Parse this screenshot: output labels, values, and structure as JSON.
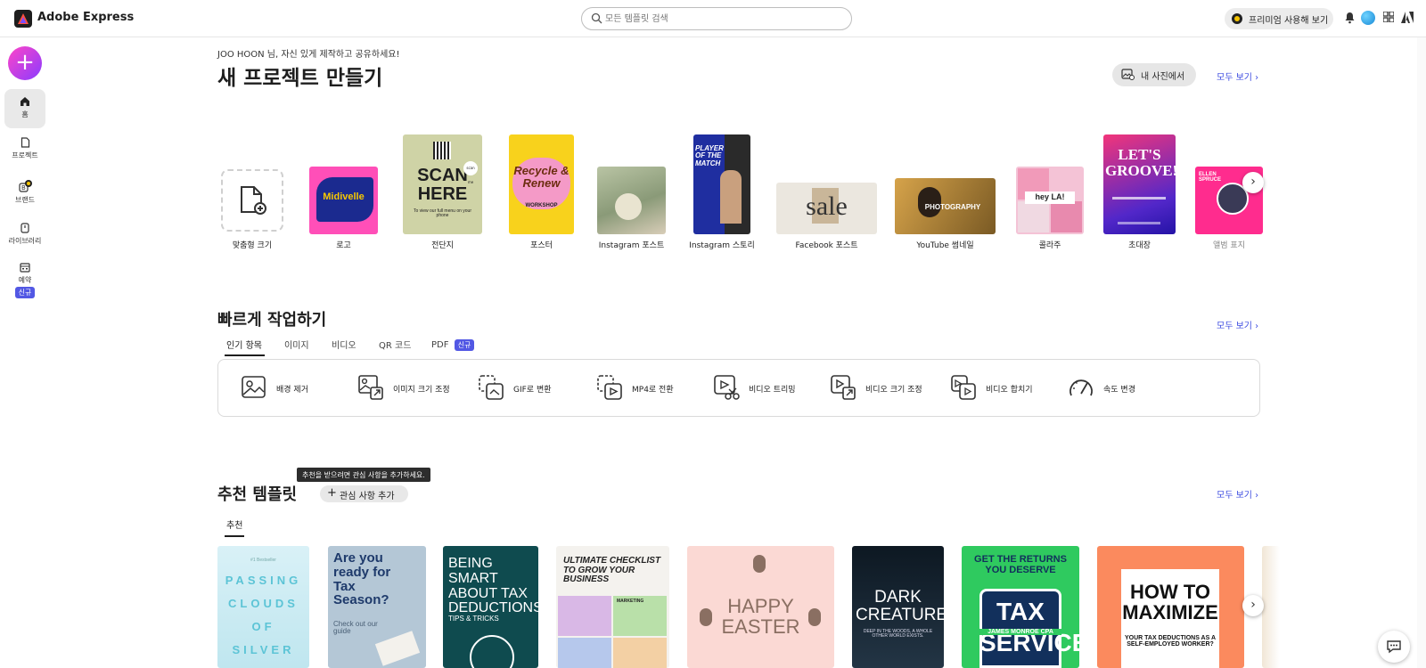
{
  "app": {
    "title": "Adobe Express"
  },
  "search": {
    "placeholder": "모든 템플릿 검색"
  },
  "header": {
    "premium_label": "프리미엄 사용해 보기"
  },
  "sidebar": {
    "create_symbol": "+",
    "items": [
      {
        "label": "홈"
      },
      {
        "label": "프로젝트"
      },
      {
        "label": "브랜드"
      },
      {
        "label": "라이브러리"
      },
      {
        "label": "예약",
        "badge": "신규"
      }
    ]
  },
  "create": {
    "greeting": "JOO HOON 님, 자신 있게 제작하고 공유하세요!",
    "title": "새 프로젝트 만들기",
    "from_photos": "내 사진에서",
    "see_all": "모두 보기",
    "cards": [
      {
        "label": "맞춤형 크기"
      },
      {
        "label": "로고",
        "art": "Midivelle"
      },
      {
        "label": "전단지",
        "art": "SCAN HERE",
        "art_sub": "To view our full menu on your phone",
        "art_tag": "scan me"
      },
      {
        "label": "포스터",
        "art": "Recycle & Renew",
        "art_sub": "WORKSHOP"
      },
      {
        "label": "Instagram 포스트"
      },
      {
        "label": "Instagram 스토리",
        "art": "PLAYER OF THE MATCH"
      },
      {
        "label": "Facebook 포스트",
        "art": "sale"
      },
      {
        "label": "YouTube 썸네일",
        "art": "PHOTOGRAPHY"
      },
      {
        "label": "콜라주",
        "art": "hey LA!"
      },
      {
        "label": "초대장",
        "art": "LET'S GROOVE!"
      },
      {
        "label": "앨범 표지",
        "art": "ELLEN SPRUCE"
      }
    ]
  },
  "quick": {
    "title": "빠르게 작업하기",
    "see_all": "모두 보기",
    "tabs": [
      {
        "label": "인기 항목"
      },
      {
        "label": "이미지"
      },
      {
        "label": "비디오"
      },
      {
        "label": "QR 코드"
      },
      {
        "label": "PDF",
        "badge": "신규"
      }
    ],
    "actions": [
      {
        "label": "배경 제거"
      },
      {
        "label": "이미지 크기 조정"
      },
      {
        "label": "GIF로 변환"
      },
      {
        "label": "MP4로 전환"
      },
      {
        "label": "비디오 트리밍"
      },
      {
        "label": "비디오 크기 조정"
      },
      {
        "label": "비디오 합치기"
      },
      {
        "label": "속도 변경"
      }
    ]
  },
  "recommended": {
    "title": "추천 템플릿",
    "tooltip": "추천을 받으려면 관심 사항을 추가하세요.",
    "add_interest": "관심 사항 추가",
    "see_all": "모두 보기",
    "tabs": [
      {
        "label": "추천"
      }
    ],
    "templates": [
      {
        "text": "PASSING CLOUDS OF SILVER",
        "sub": "#1 Bestseller"
      },
      {
        "text": "Are you ready for Tax Season?",
        "sub": "Check out our guide"
      },
      {
        "text": "BEING SMART ABOUT TAX DEDUCTIONS",
        "sub": "TIPS & TRICKS"
      },
      {
        "text": "ULTIMATE CHECKLIST TO GROW YOUR BUSINESS",
        "sub": "MARKETING"
      },
      {
        "text": "HAPPY EASTER"
      },
      {
        "text": "DARK CREATURES",
        "sub": "DEEP IN THE WOODS, A WHOLE OTHER WORLD EXISTS."
      },
      {
        "text": "TAX SERVICES",
        "sub": "GET THE RETURNS YOU DESERVE",
        "sub2": "JAMES MONROE CPA"
      },
      {
        "text": "HOW TO MAXIMIZE",
        "sub": "YOUR TAX DEDUCTIONS AS A SELF-EMPLOYED WORKER?"
      }
    ]
  }
}
